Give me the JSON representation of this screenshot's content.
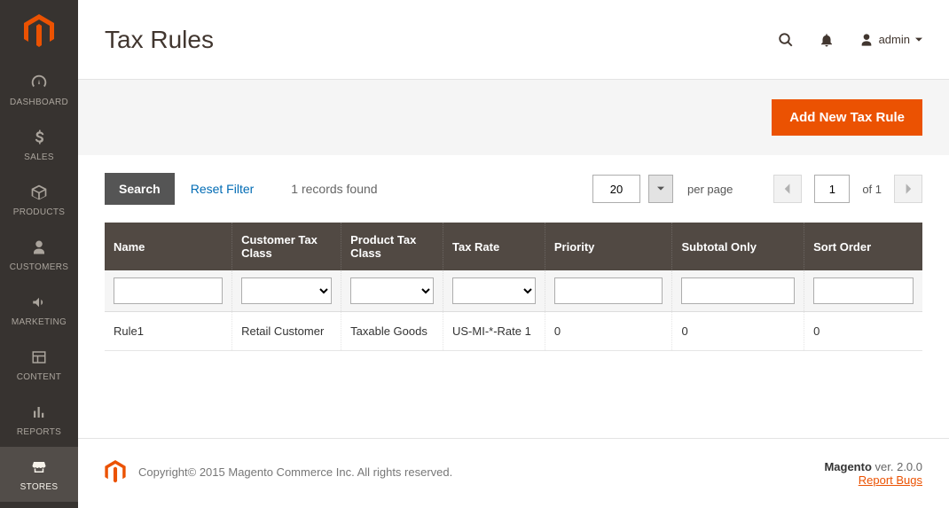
{
  "sidebar": {
    "items": [
      {
        "label": "DASHBOARD"
      },
      {
        "label": "SALES"
      },
      {
        "label": "PRODUCTS"
      },
      {
        "label": "CUSTOMERS"
      },
      {
        "label": "MARKETING"
      },
      {
        "label": "CONTENT"
      },
      {
        "label": "REPORTS"
      },
      {
        "label": "STORES"
      }
    ]
  },
  "header": {
    "title": "Tax Rules",
    "user": "admin"
  },
  "toolbar": {
    "add_button": "Add New Tax Rule"
  },
  "controls": {
    "search": "Search",
    "reset": "Reset Filter",
    "records_found": "1 records found",
    "per_page_value": "20",
    "per_page_label": "per page",
    "page_value": "1",
    "page_of": "of 1"
  },
  "table": {
    "headers": {
      "name": "Name",
      "customer_tax_class": "Customer Tax Class",
      "product_tax_class": "Product Tax Class",
      "tax_rate": "Tax Rate",
      "priority": "Priority",
      "subtotal_only": "Subtotal Only",
      "sort_order": "Sort Order"
    },
    "rows": [
      {
        "name": "Rule1",
        "customer_tax_class": "Retail Customer",
        "product_tax_class": "Taxable Goods",
        "tax_rate": "US-MI-*-Rate 1",
        "priority": "0",
        "subtotal_only": "0",
        "sort_order": "0"
      }
    ]
  },
  "footer": {
    "copyright": "Copyright© 2015 Magento Commerce Inc. All rights reserved.",
    "brand": "Magento",
    "version": " ver. 2.0.0",
    "report_bugs": "Report Bugs"
  }
}
